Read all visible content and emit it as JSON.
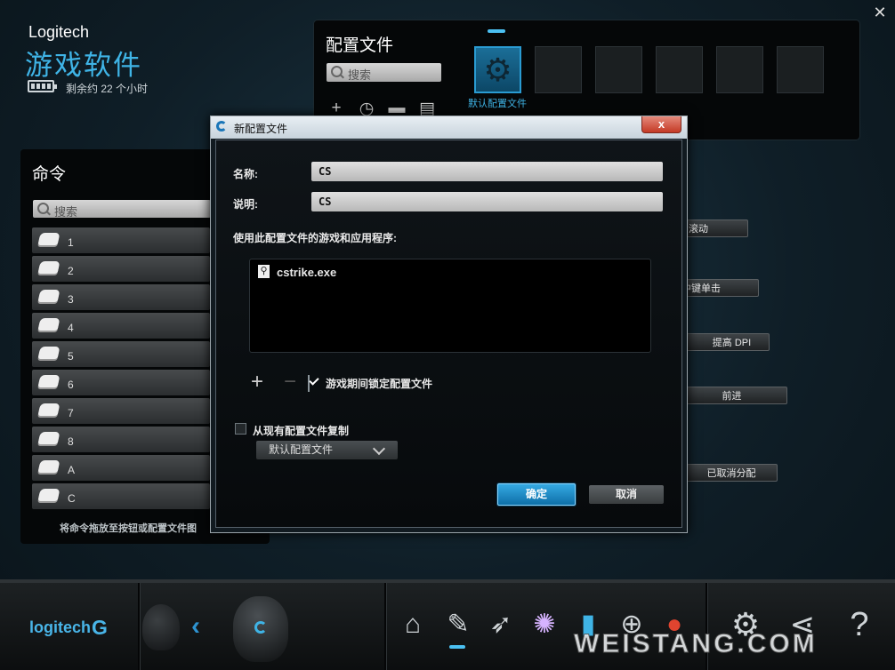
{
  "brand": {
    "name": "Logitech",
    "app_title": "游戏软件",
    "battery_text": "剩余约 22 个小时"
  },
  "profiles": {
    "title": "配置文件",
    "search_placeholder": "搜索",
    "default_profile_label": "默认配置文件",
    "empty_slots": 5
  },
  "commands": {
    "title": "命令",
    "search_placeholder": "搜索",
    "items": [
      "1",
      "2",
      "3",
      "4",
      "5",
      "6",
      "7",
      "8",
      "A",
      "C"
    ],
    "hint": "将命令拖放至按钮或配置文件图"
  },
  "assignments": [
    "滚动",
    "中键单击",
    "提高 DPI",
    "前进",
    "已取消分配"
  ],
  "dialog": {
    "title": "新配置文件",
    "close_label": "x",
    "name_label": "名称:",
    "name_value": "CS",
    "desc_label": "说明:",
    "desc_value": "CS",
    "games_label": "使用此配置文件的游戏和应用程序:",
    "games": [
      {
        "name": "cstrike.exe"
      }
    ],
    "add_label": "+",
    "remove_label": "−",
    "lock_label": "游戏期间锁定配置文件",
    "lock_checked": true,
    "copy_label": "从现有配置文件复制",
    "copy_checked": false,
    "copy_from": "默认配置文件",
    "ok": "确定",
    "cancel": "取消"
  },
  "bottom": {
    "logo": "logitech",
    "watermark": "WEISTANG.COM"
  },
  "colors": {
    "accent": "#3fb4e6",
    "panel": "#050708",
    "background": "#122631"
  }
}
